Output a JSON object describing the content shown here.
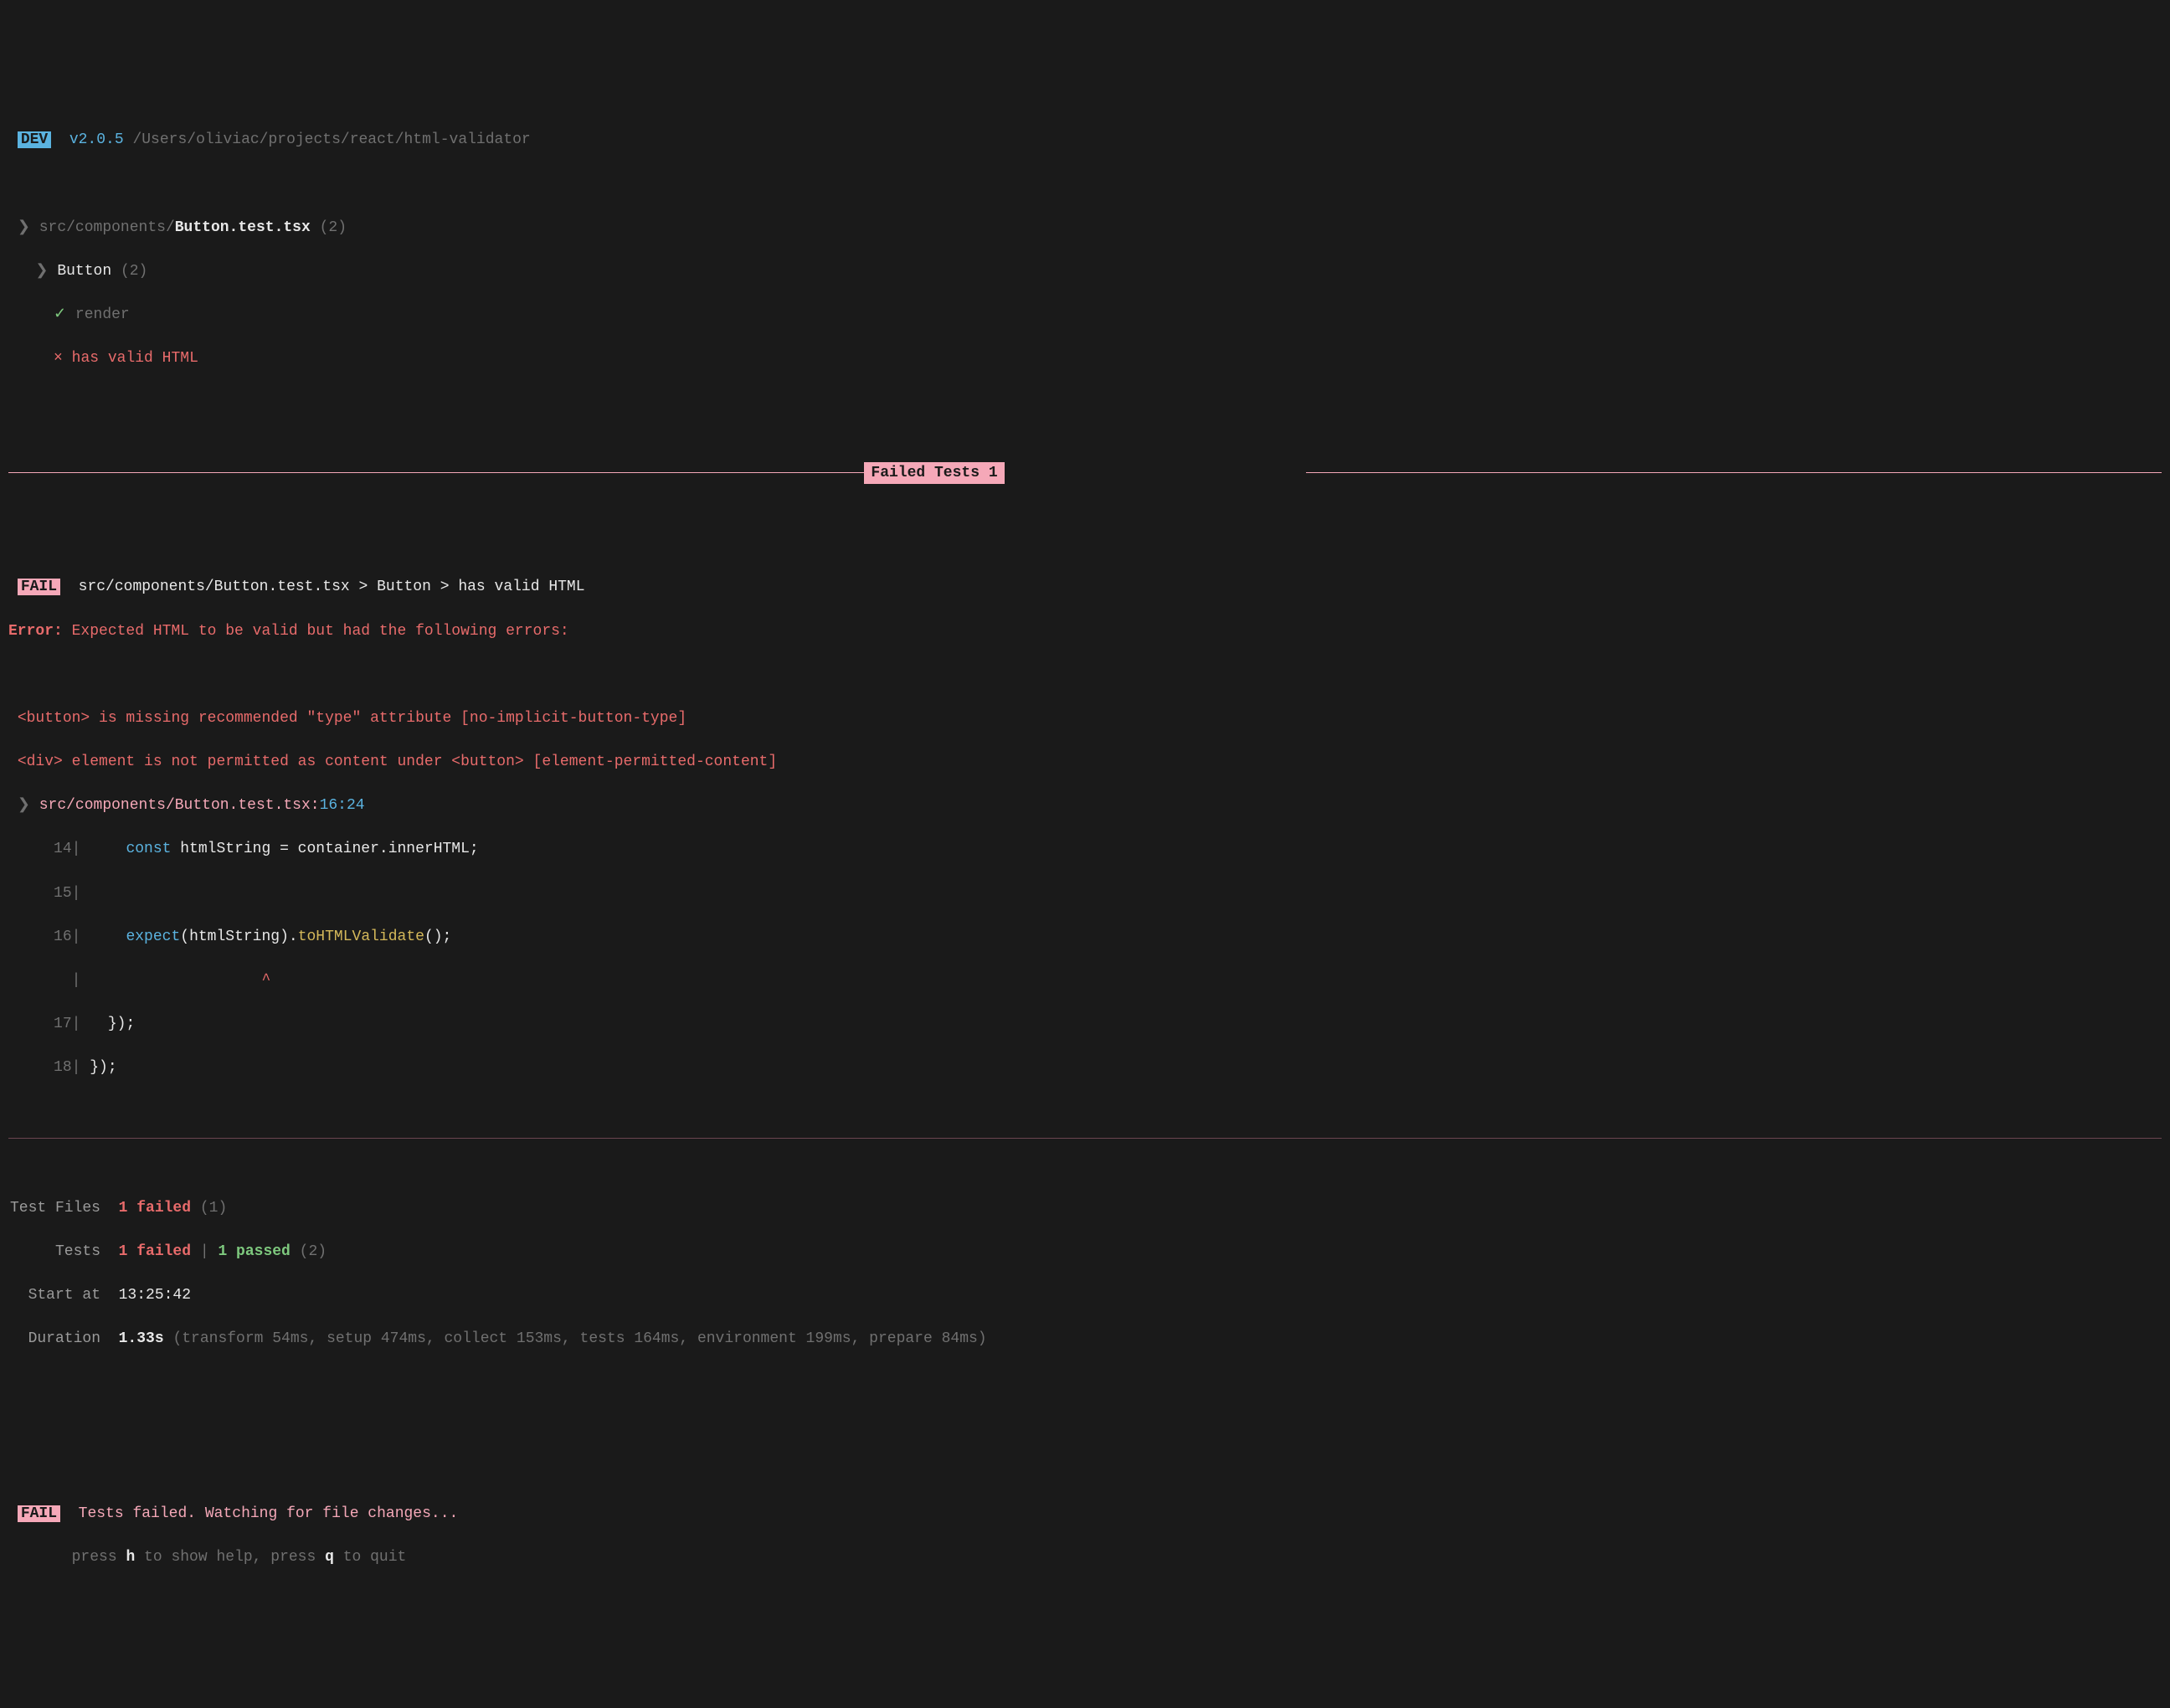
{
  "header": {
    "mode": "DEV",
    "version": "v2.0.5",
    "cwd": "/Users/oliviac/projects/react/html-validator"
  },
  "tree": {
    "file_prefix": "src/components/",
    "file_name": "Button.test.tsx",
    "file_count": "(2)",
    "suite_name": "Button",
    "suite_count": "(2)",
    "test_pass": "render",
    "test_fail": "has valid HTML"
  },
  "failed_header": "Failed Tests 1",
  "failure": {
    "badge": "FAIL",
    "path": "src/components/Button.test.tsx > Button > has valid HTML",
    "error_label": "Error:",
    "error_msg": "Expected HTML to be valid but had the following errors:",
    "details": [
      "<button> is missing recommended \"type\" attribute [no-implicit-button-type]",
      "<div> element is not permitted as content under <button> [element-permitted-content]"
    ],
    "location_file": "src/components/Button.test.tsx:",
    "location_pos": "16:24",
    "code": {
      "l14_num": "14",
      "l14_a": "    const",
      "l14_b": " htmlString = container.innerHTML;",
      "l15_num": "15",
      "l16_num": "16",
      "l16_a": "    expect",
      "l16_b": "(htmlString).",
      "l16_c": "toHTMLValidate",
      "l16_d": "();",
      "caret": "                   ^",
      "l17_num": "17",
      "l17_body": "  });",
      "l18_num": "18",
      "l18_body": "});"
    }
  },
  "summary": {
    "test_files_label": "Test Files",
    "test_files_fail": "1 failed",
    "test_files_count": "(1)",
    "tests_label": "Tests",
    "tests_fail": "1 failed",
    "tests_sep": " | ",
    "tests_pass": "1 passed",
    "tests_count": "(2)",
    "start_label": "Start at",
    "start_value": "13:25:42",
    "duration_label": "Duration",
    "duration_value": "1.33s",
    "duration_breakdown": "(transform 54ms, setup 474ms, collect 153ms, tests 164ms, environment 199ms, prepare 84ms)"
  },
  "footer": {
    "badge": "FAIL",
    "status": "Tests failed. Watching for file changes...",
    "help_a": "press ",
    "help_h": "h",
    "help_b": " to show help, press ",
    "help_q": "q",
    "help_c": " to quit"
  }
}
